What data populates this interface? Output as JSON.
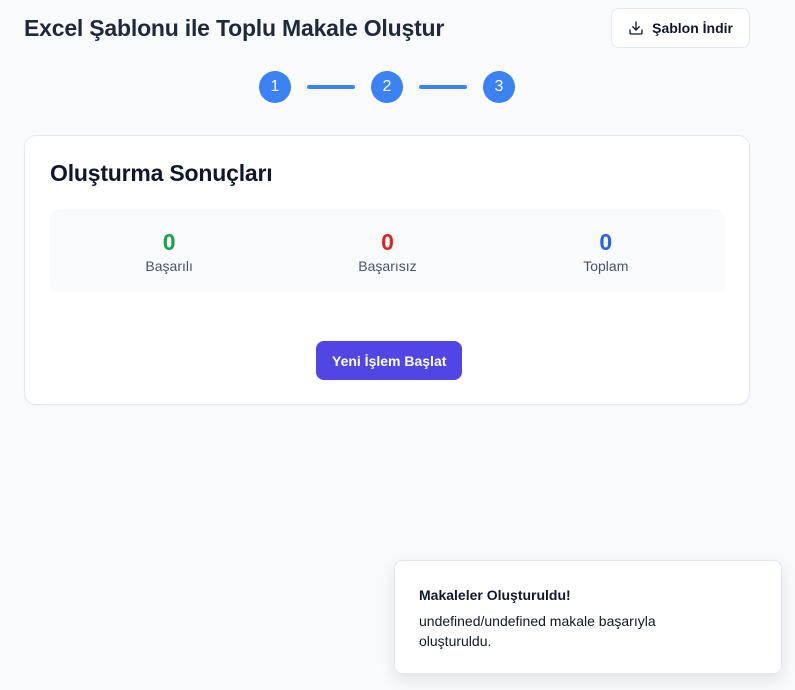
{
  "header": {
    "title": "Excel Şablonu ile Toplu Makale Oluştur",
    "download_button": "Şablon İndir"
  },
  "stepper": {
    "steps": [
      "1",
      "2",
      "3"
    ],
    "color": "#3b82f6"
  },
  "results": {
    "title": "Oluşturma Sonuçları",
    "stats": [
      {
        "value": "0",
        "label": "Başarılı",
        "color": "#16a34a"
      },
      {
        "value": "0",
        "label": "Başarısız",
        "color": "#dc2626"
      },
      {
        "value": "0",
        "label": "Toplam",
        "color": "#2563eb"
      }
    ],
    "new_button": "Yeni İşlem Başlat"
  },
  "toast": {
    "title": "Makaleler Oluşturuldu!",
    "message": "undefined/undefined makale başarıyla oluşturuldu."
  },
  "colors": {
    "primary": "#4f46e5",
    "step": "#3b82f6"
  },
  "icons": {
    "download": "download-icon"
  }
}
